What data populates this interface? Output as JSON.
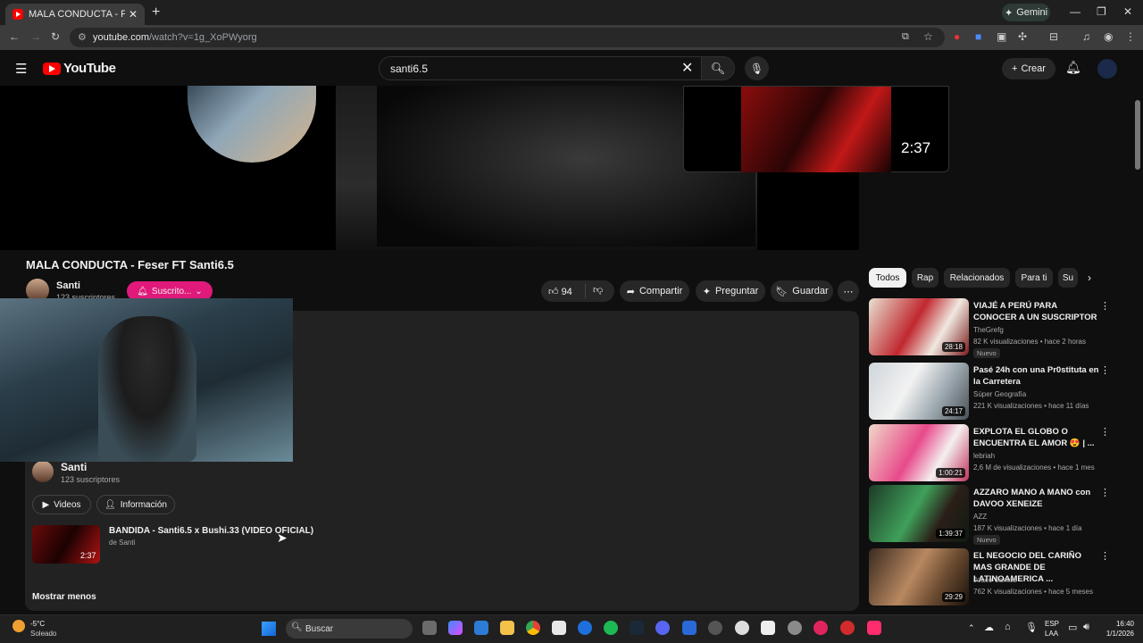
{
  "browser": {
    "tab_title": "MALA CONDUCTA - Feser FT Sa",
    "tab_close": "✕",
    "new_tab": "+",
    "gemini_label": "Gemini",
    "url_host": "youtube.com",
    "url_path": "/watch?v=1g_XoPWyorg",
    "win_minimize": "—",
    "win_restore": "❐",
    "win_close": "✕"
  },
  "masthead": {
    "logo_text": "YouTube",
    "search_value": "santi6.5",
    "create_label": "Crear"
  },
  "player": {
    "mini_duration": "2:37"
  },
  "video": {
    "title": "MALA CONDUCTA - Feser FT Santi6.5",
    "channel": "Santi",
    "subscribers": "123 suscriptores",
    "subscribe_label": "Suscrito...",
    "likes": "94",
    "share_label": "Compartir",
    "ask_label": "Preguntar",
    "save_label": "Guardar",
    "more": "⋯"
  },
  "description": {
    "channel": "Santi",
    "subscribers": "123 suscriptores",
    "videos_label": "Videos",
    "info_label": "Información",
    "related_title": "BANDIDA - Santi6.5 x Bushi.33 (VIDEO OFICIAL)",
    "related_by": "de Santi",
    "related_duration": "2:37",
    "show_less": "Mostrar menos"
  },
  "chips": [
    "Todos",
    "Rap",
    "Relacionados",
    "Para ti",
    "Su"
  ],
  "recommendations": [
    {
      "title": "VIAJÉ A PERÚ PARA CONOCER A UN SUSCRIPTOR",
      "channel": "TheGrefg",
      "meta": "82 K visualizaciones • hace 2 horas",
      "badge": "Nuevo",
      "duration": "28:18"
    },
    {
      "title": "Pasé 24h con una Pr0stituta en la Carretera",
      "channel": "Súper Geografía",
      "meta": "221 K visualizaciones • hace 11 días",
      "badge": "",
      "duration": "24:17"
    },
    {
      "title": "EXPLOTA EL GLOBO O ENCUENTRA EL AMOR 😍 | ...",
      "channel": "lebriah",
      "meta": "2,6 M de visualizaciones • hace 1 mes",
      "badge": "",
      "duration": "1:00:21"
    },
    {
      "title": "AZZARO MANO A MANO con DAVOO XENEIZE",
      "channel": "AZZ",
      "meta": "187 K visualizaciones • hace 1 día",
      "badge": "Nuevo",
      "duration": "1:39:37"
    },
    {
      "title": "EL NEGOCIO DEL CARIÑO MAS GRANDE DE LATINOAMERICA ...",
      "channel": "Joaco Santos",
      "meta": "762 K visualizaciones • hace 5 meses",
      "badge": "",
      "duration": "29:29"
    }
  ],
  "taskbar": {
    "temperature": "-5°C",
    "weather": "Soleado",
    "search_label": "Buscar",
    "lang1": "ESP",
    "lang2": "LAA",
    "time": "16:40",
    "date": "1/1/2026"
  }
}
